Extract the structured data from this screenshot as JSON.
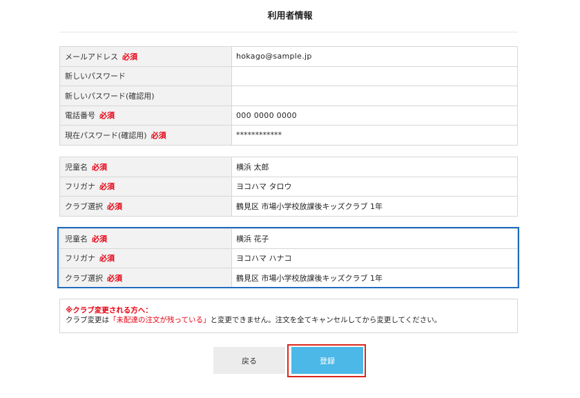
{
  "page": {
    "title": "利用者情報"
  },
  "account": {
    "email_label": "メールアドレス",
    "email_value": "hokago@sample.jp",
    "new_password_label": "新しいパスワード",
    "new_password_value": "",
    "new_password_confirm_label": "新しいパスワード(確認用)",
    "new_password_confirm_value": "",
    "phone_label": "電話番号",
    "phone_value": "000 0000 0000",
    "current_password_label": "現在パスワード(確認用)",
    "current_password_value": "************"
  },
  "required_label": "必須",
  "children": [
    {
      "name_label": "児童名",
      "name_value": "横浜 太郎",
      "kana_label": "フリガナ",
      "kana_value": "ヨコハマ タロウ",
      "club_label": "クラブ選択",
      "club_value": "鶴見区 市場小学校放課後キッズクラブ 1年"
    },
    {
      "name_label": "児童名",
      "name_value": "横浜 花子",
      "kana_label": "フリガナ",
      "kana_value": "ヨコハマ ハナコ",
      "club_label": "クラブ選択",
      "club_value": "鶴見区 市場小学校放課後キッズクラブ 1年"
    }
  ],
  "notice": {
    "title": "※クラブ変更される方へ：",
    "body_before": "クラブ変更は",
    "body_highlight": "「未配達の注文が残っている」",
    "body_after": "と変更できません。注文を全てキャンセルしてから変更してください。"
  },
  "buttons": {
    "back_label": "戻る",
    "register_label": "登録"
  },
  "colors": {
    "required": "#e60012",
    "highlight_border": "#1e6bbd",
    "register_button": "#4bb8e8",
    "register_frame": "#d9261c"
  }
}
